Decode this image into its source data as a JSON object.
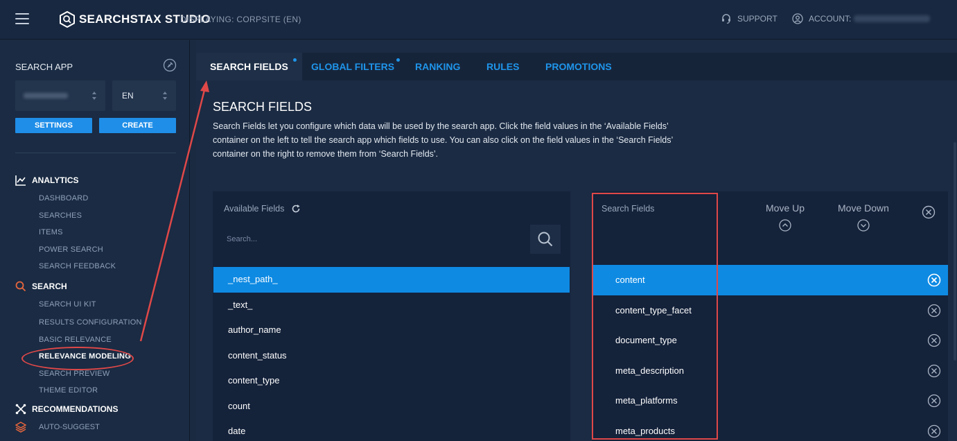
{
  "topbar": {
    "brand": "SEARCHSTAX STUDIO",
    "displaying": "DISPLAYING: CORPSITE (EN)",
    "support_label": "SUPPORT",
    "account_label": "ACCOUNT:"
  },
  "sidebar": {
    "title": "SEARCH APP",
    "language_value": "EN",
    "settings_label": "SETTINGS",
    "create_label": "CREATE",
    "analytics": {
      "label": "ANALYTICS",
      "items": [
        "DASHBOARD",
        "SEARCHES",
        "ITEMS",
        "POWER SEARCH",
        "SEARCH FEEDBACK"
      ]
    },
    "search": {
      "label": "SEARCH",
      "items": [
        "SEARCH UI KIT",
        "RESULTS CONFIGURATION",
        "BASIC RELEVANCE",
        "RELEVANCE MODELING",
        "SEARCH PREVIEW",
        "THEME EDITOR"
      ]
    },
    "recommendations": {
      "label": "RECOMMENDATIONS"
    },
    "auto_suggest": {
      "label": "AUTO-SUGGEST"
    }
  },
  "tabs": [
    "SEARCH FIELDS",
    "GLOBAL FILTERS",
    "RANKING",
    "RULES",
    "PROMOTIONS"
  ],
  "panel": {
    "title": "SEARCH FIELDS",
    "description": "Search Fields let you configure which data will be used by the search app. Click the field values in the ‘Available Fields’ container on the left to tell the search app which fields to use. You can also click on the field values in the ‘Search Fields’ container on the right to remove them from ‘Search Fields’."
  },
  "available": {
    "title": "Available Fields",
    "search_placeholder": "Search...",
    "fields": [
      "_nest_path_",
      "_text_",
      "author_name",
      "content_status",
      "content_type",
      "count",
      "date"
    ]
  },
  "search_fields": {
    "title": "Search Fields",
    "move_up_label": "Move Up",
    "move_down_label": "Move Down",
    "fields": [
      "content",
      "content_type_facet",
      "document_type",
      "meta_description",
      "meta_platforms",
      "meta_products"
    ]
  },
  "colors": {
    "accent": "#1f95ea",
    "selected": "#0e8ae3",
    "annotation": "#e04848",
    "search_icon": "#e8663d"
  }
}
